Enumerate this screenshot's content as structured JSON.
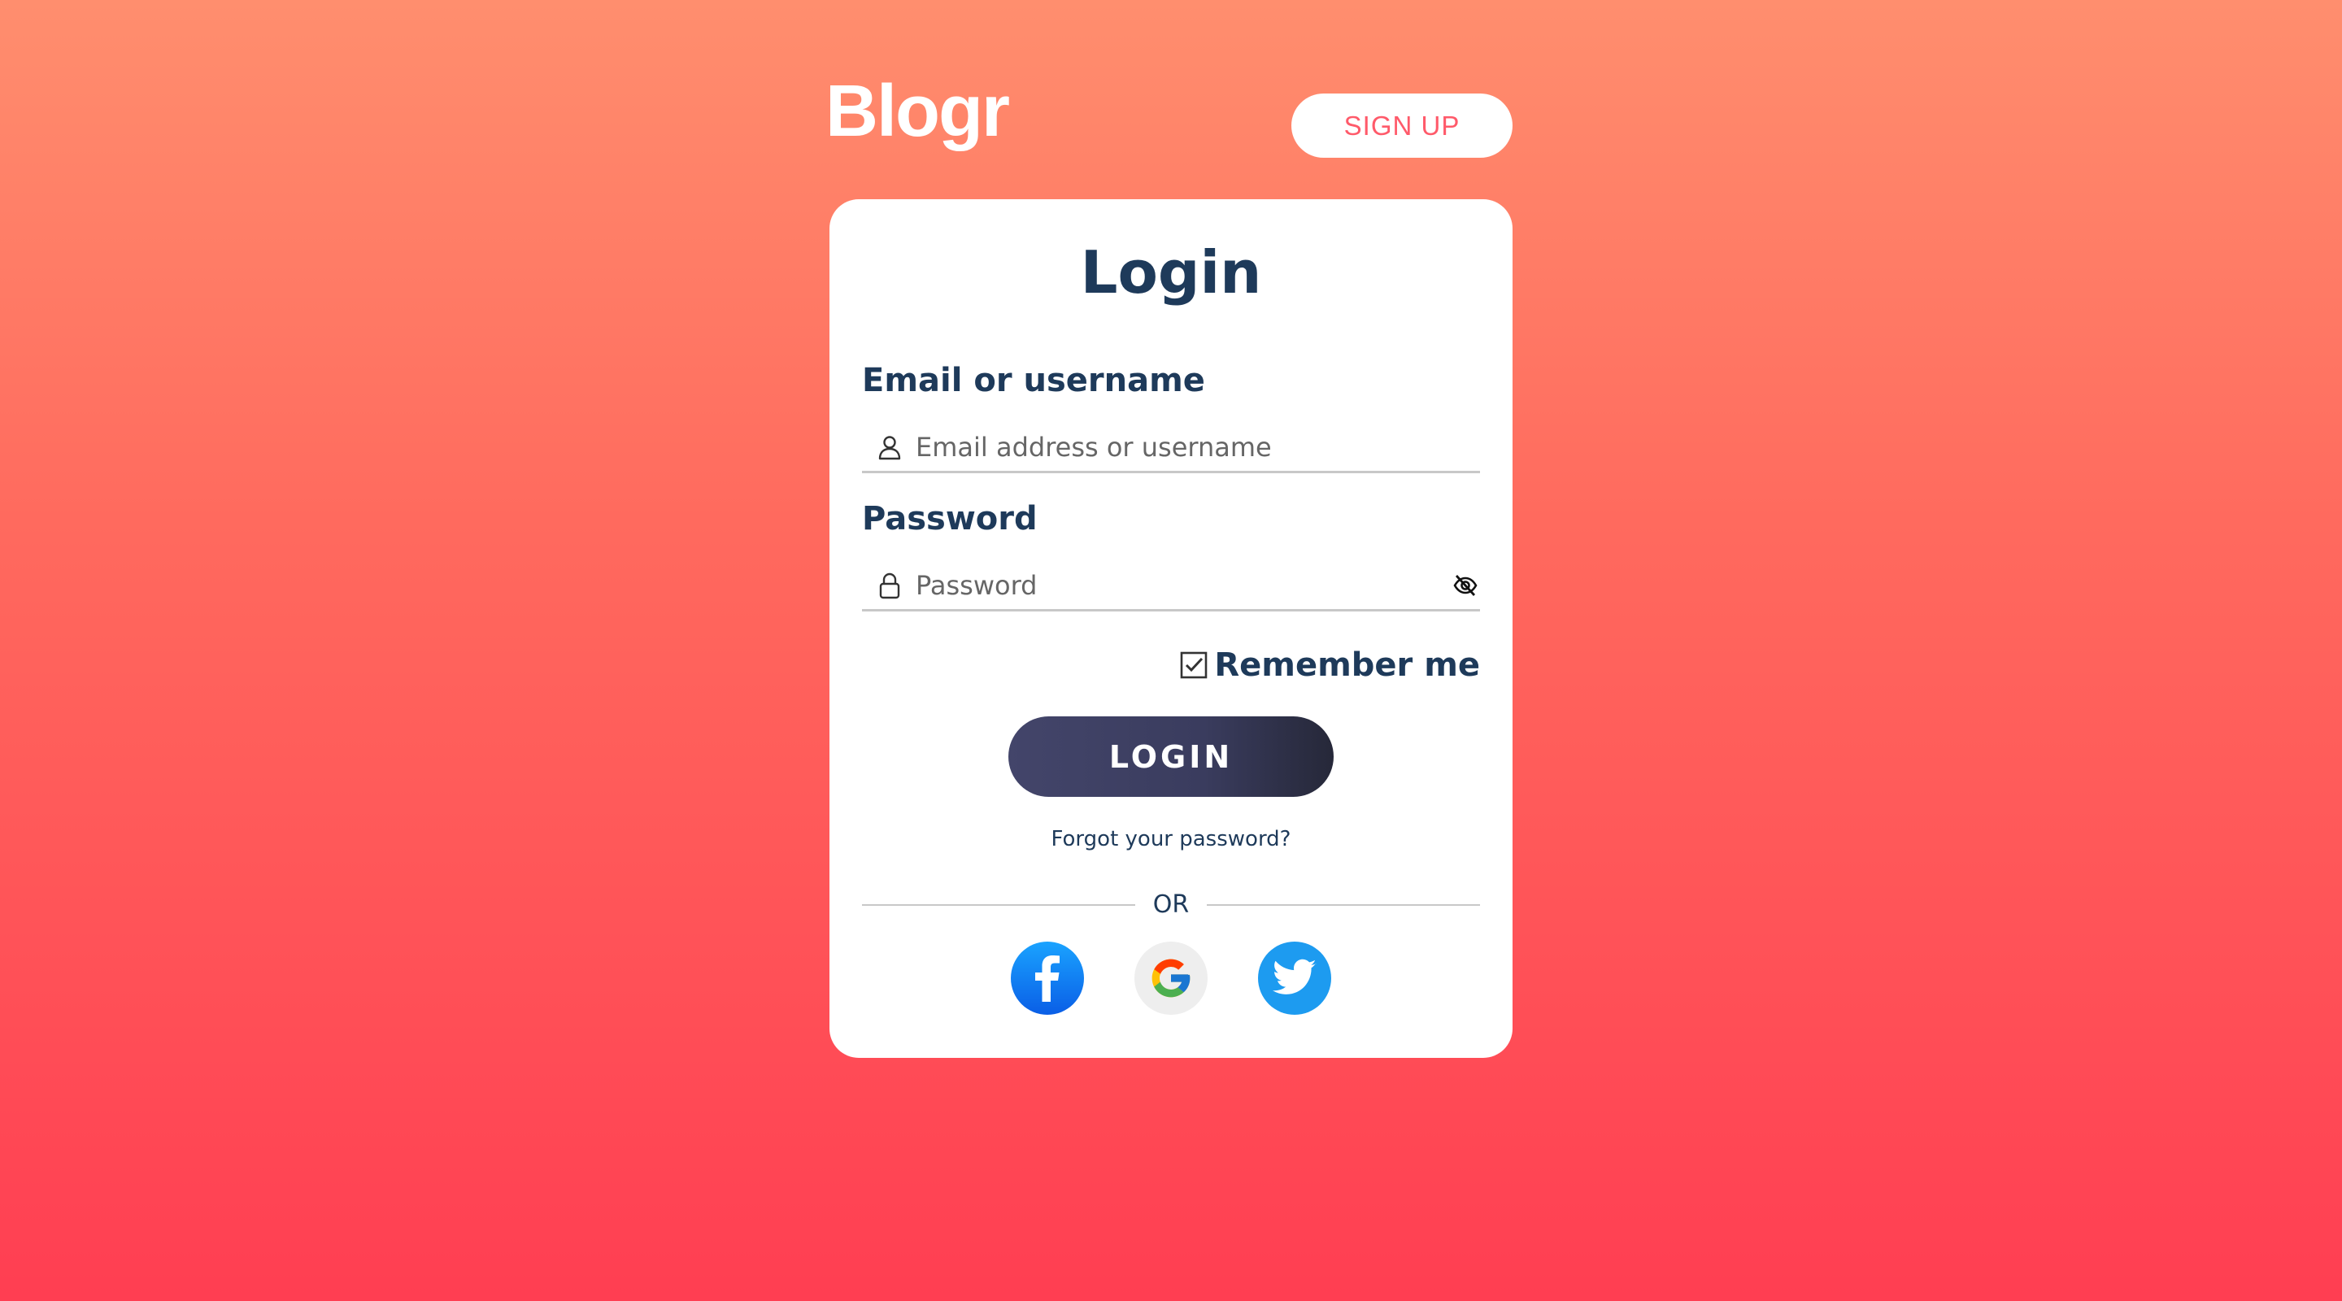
{
  "header": {
    "brand": "Blogr",
    "signup_label": "SIGN UP"
  },
  "login": {
    "title": "Login",
    "email_label": "Email or username",
    "email_placeholder": "Email address or username",
    "email_value": "",
    "password_label": "Password",
    "password_placeholder": "Password",
    "password_value": "",
    "remember_label": "Remember me",
    "remember_checked": true,
    "submit_label": "LOGIN",
    "forgot_label": "Forgot your password?",
    "divider_label": "OR"
  },
  "socials": [
    {
      "name": "facebook-icon",
      "color": "#1877f2"
    },
    {
      "name": "google-icon",
      "color": "#eeeeee"
    },
    {
      "name": "twitter-icon",
      "color": "#1d9bf0"
    }
  ],
  "colors": {
    "accent": "#ff5a6a",
    "text": "#1e3a5a",
    "button": "#3a3c5e"
  }
}
